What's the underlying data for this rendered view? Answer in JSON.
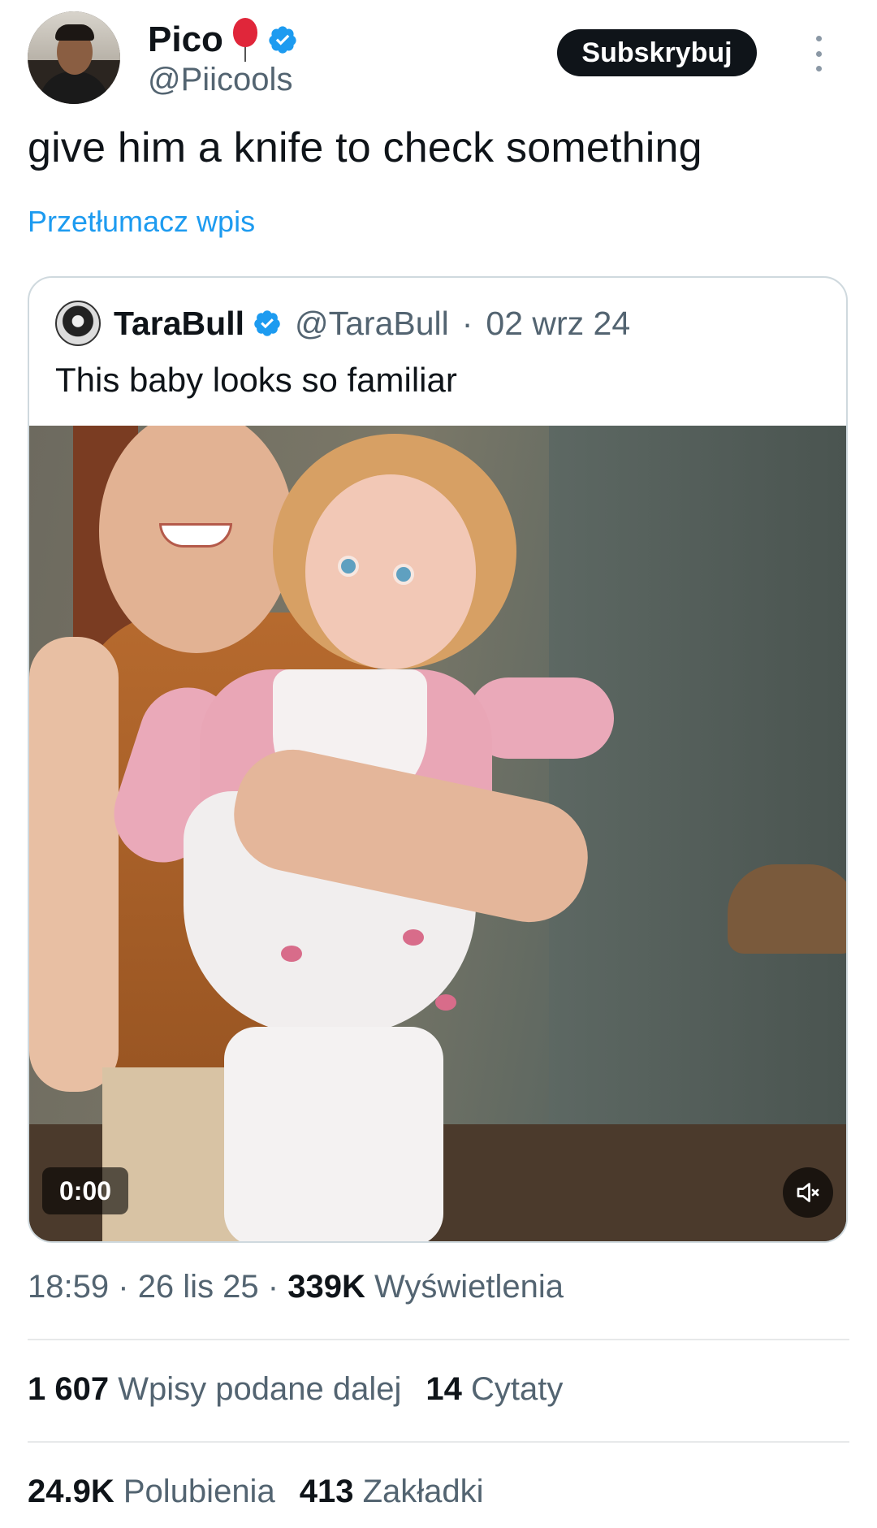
{
  "author": {
    "name": "Pico",
    "handle": "@Piicools",
    "verified": true,
    "badge_icon": "balloon-icon"
  },
  "actions": {
    "subscribe_label": "Subskrybuj",
    "more_icon": "more-vertical-icon"
  },
  "tweet": {
    "text": "give him a knife to check something",
    "translate_label": "Przetłumacz wpis"
  },
  "quote": {
    "name": "TaraBull",
    "handle": "@TaraBull",
    "separator": "·",
    "date": "02 wrz 24",
    "text": "This baby looks so familiar",
    "video": {
      "timestamp": "0:00",
      "mute_icon": "volume-muted-icon"
    }
  },
  "meta": {
    "time": "18:59",
    "sep1": "·",
    "date": "26 lis 25",
    "sep2": "·",
    "views_count": "339K",
    "views_label": "Wyświetlenia"
  },
  "stats": {
    "reposts_count": "1 607",
    "reposts_label": "Wpisy podane dalej",
    "quotes_count": "14",
    "quotes_label": "Cytaty",
    "likes_count": "24.9K",
    "likes_label": "Polubienia",
    "bookmarks_count": "413",
    "bookmarks_label": "Zakładki"
  },
  "colors": {
    "accent": "#1d9bf0",
    "text": "#0f1419",
    "secondary": "#536471",
    "border": "#cfd9de"
  }
}
